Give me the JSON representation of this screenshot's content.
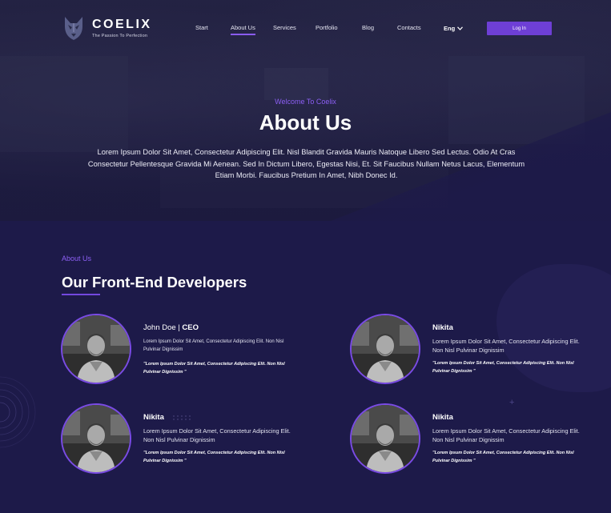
{
  "brand": {
    "name": "COELIX",
    "tagline": "The Passion To Perfection"
  },
  "nav": {
    "items": [
      {
        "label": "Start"
      },
      {
        "label": "About Us",
        "active": true
      },
      {
        "label": "Services"
      },
      {
        "label": "Portfolio"
      },
      {
        "label": "Blog"
      },
      {
        "label": "Contacts"
      }
    ],
    "language": "Eng",
    "login_label": "Log In"
  },
  "hero": {
    "eyebrow": "Welcome To Coelix",
    "title": "About Us",
    "description": "Lorem Ipsum Dolor Sit Amet, Consectetur Adipiscing Elit. Nisl Blandit Gravida Mauris Natoque Libero Sed Lectus. Odio At Cras Consectetur Pellentesque Gravida Mi Aenean. Sed In Dictum Libero, Egestas Nisi, Et. Sit Faucibus Nullam Netus Lacus, Elementum Etiam Morbi. Faucibus Pretium In Amet, Nibh Donec Id."
  },
  "about": {
    "eyebrow": "About Us",
    "title": "Our Front-End Developers",
    "developers": [
      {
        "name": "John Doe",
        "separator": " | ",
        "role": "CEO",
        "text": "Lorem Ipsum Dolor Sit Amet, Consectetur Adipiscing Elit. Non Nisl Pulvinar Dignissim",
        "quote": "\"Lorem Ipsum Dolor Sit Amet, Consectetur Adipiscing Elit. Non Nisl Pulvinar Dignissim \""
      },
      {
        "name": "Nikita",
        "text": "Lorem Ipsum Dolor Sit Amet, Consectetur Adipiscing Elit. Non Nisl Pulvinar Dignissim",
        "quote": "\"Lorem Ipsum Dolor Sit Amet, Consectetur Adipiscing Elit. Non Nisl Pulvinar Dignissim \""
      },
      {
        "name": "Nikita",
        "text": "Lorem Ipsum Dolor Sit Amet, Consectetur Adipiscing Elit. Non Nisl Pulvinar Dignissim",
        "quote": "\"Lorem Ipsum Dolor Sit Amet, Consectetur Adipiscing Elit. Non Nisl Pulvinar Dignissim \""
      },
      {
        "name": "Nikita",
        "text": "Lorem Ipsum Dolor Sit Amet, Consectetur Adipiscing Elit. Non Nisl Pulvinar Dignissim",
        "quote": "\"Lorem Ipsum Dolor Sit Amet, Consectetur Adipiscing Elit. Non Nisl Pulvinar Dignissim \""
      }
    ]
  },
  "colors": {
    "accent": "#8c5ff4",
    "button": "#6e3fd6",
    "background": "#1d1a49"
  },
  "icons": {
    "logo": "wolf-head-icon",
    "language_dropdown": "chevron-down-icon"
  }
}
